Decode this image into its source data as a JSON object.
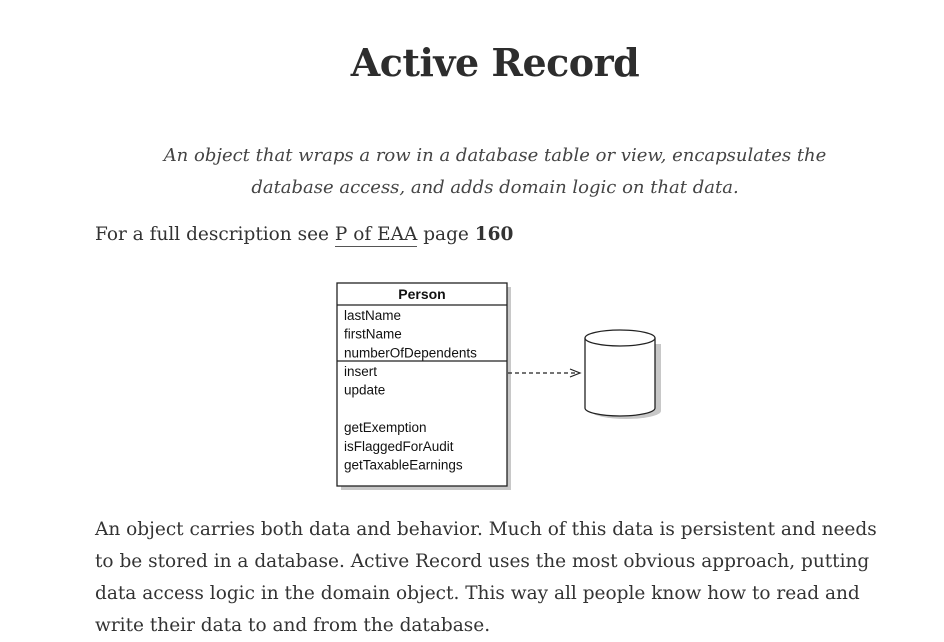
{
  "page": {
    "title": "Active Record",
    "intent": "An object that wraps a row in a database table or view, encapsulates the database access, and adds domain logic on that data.",
    "reference": {
      "prefix": "For a full description see ",
      "link_text": "P of EAA",
      "middle": " page ",
      "page_number": "160"
    },
    "body": "An object carries both data and behavior. Much of this data is persistent and needs to be stored in a database. Active Record uses the most obvious approach, putting data access logic in the domain object. This way all people know how to read and write their data to and from the database."
  },
  "diagram": {
    "class_name": "Person",
    "attributes": [
      "lastName",
      "firstName",
      "numberOfDependents"
    ],
    "methods": [
      "insert",
      "update",
      "",
      "getExemption",
      "isFlaggedForAudit",
      "getTaxableEarnings"
    ]
  }
}
